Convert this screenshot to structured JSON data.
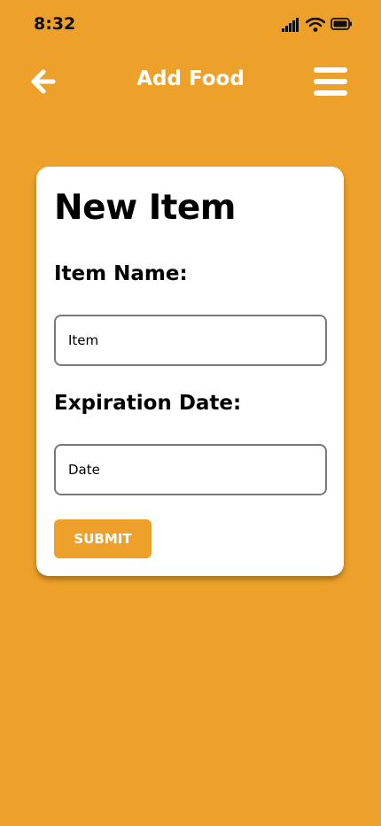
{
  "status_bar": {
    "time": "8:32",
    "icons": [
      "cellular-signal-icon",
      "wifi-icon",
      "battery-icon"
    ]
  },
  "header": {
    "title": "Add Food",
    "back_icon": "arrow-left-icon",
    "menu_icon": "hamburger-menu-icon"
  },
  "form": {
    "title": "New Item",
    "item_name_label": "Item Name:",
    "item_placeholder": "Item",
    "expiration_label": "Expiration Date:",
    "date_placeholder": "Date",
    "submit_label": "SUBMIT"
  },
  "colors": {
    "background": "#EDA02A",
    "accent": "#EDA02A",
    "card": "#FFFFFF"
  }
}
